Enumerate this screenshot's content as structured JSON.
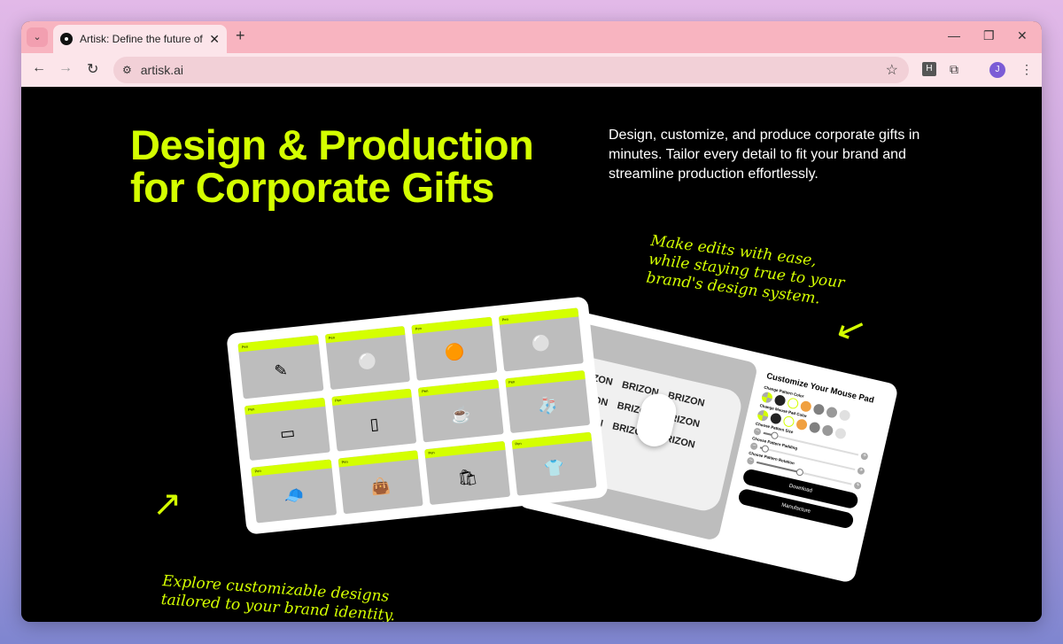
{
  "browser": {
    "tab_title": "Artisk: Define the future of brand",
    "url": "artisk.ai",
    "profile_initial": "J",
    "extension_letter": "H"
  },
  "hero": {
    "title_line1": "Design & Production",
    "title_line2": "for Corporate Gifts",
    "description": "Design, customize, and produce corporate gifts in minutes. Tailor every detail to fit your brand and streamline production effortlessly.",
    "note_right": [
      "Make edits with ease,",
      "while staying true to your",
      "brand's design system."
    ],
    "note_left": [
      "Explore customizable designs",
      "tailored to your brand identity."
    ]
  },
  "catalog": {
    "cards": [
      {
        "label": "Pen",
        "product": "pen"
      },
      {
        "label": "Pen",
        "product": "keychain"
      },
      {
        "label": "Pen",
        "product": "coaster"
      },
      {
        "label": "Pen",
        "product": "button-badge"
      },
      {
        "label": "Pen",
        "product": "mouse-pad"
      },
      {
        "label": "Pen",
        "product": "notebook"
      },
      {
        "label": "Pen",
        "product": "mug"
      },
      {
        "label": "Pen",
        "product": "sock"
      },
      {
        "label": "Pen",
        "product": "cap"
      },
      {
        "label": "Pen",
        "product": "tote-bag"
      },
      {
        "label": "Pen",
        "product": "shopping-bag"
      },
      {
        "label": "Pen",
        "product": "t-shirt"
      }
    ],
    "brand_text": "BRIZON"
  },
  "customizer": {
    "title": "Customize Your Mouse Pad",
    "pattern_color_label": "Change Pattern Color",
    "pad_color_label": "Change Mouse Pad Color",
    "swatches": [
      "#d4ff00",
      "#222222",
      "#ffffff",
      "#f0a040",
      "#808080",
      "#999999",
      "#e0e0e0"
    ],
    "sliders": [
      {
        "label": "Choose Pattern Size",
        "value": 0.12
      },
      {
        "label": "Choose Pattern Padding",
        "value": 0.05
      },
      {
        "label": "Choose Pattern Rotation",
        "value": 0.45
      }
    ],
    "download_label": "Download",
    "manufacture_label": "Manufacture"
  },
  "colors": {
    "accent": "#d4ff00",
    "background": "#000000",
    "tabbar": "#f8b4c0"
  }
}
